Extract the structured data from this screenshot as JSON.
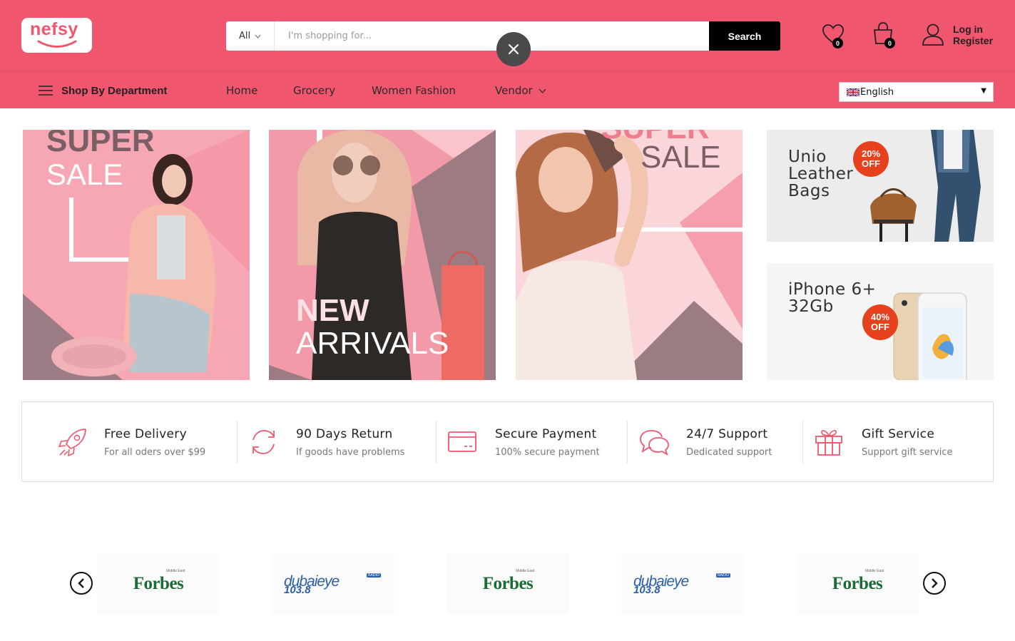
{
  "header": {
    "logo_text": "nefsy",
    "search": {
      "category": "All",
      "placeholder": "I'm shopping for...",
      "value": "",
      "button_label": "Search"
    },
    "wishlist_count": "0",
    "cart_count": "0",
    "account": {
      "login_label": "Log in",
      "register_label": "Register"
    },
    "brand_color": "#f0566e"
  },
  "nav": {
    "department_label": "Shop By Department",
    "items": [
      {
        "label": "Home"
      },
      {
        "label": "Grocery"
      },
      {
        "label": "Women Fashion"
      },
      {
        "label": "Vendor"
      }
    ],
    "language": "English"
  },
  "banners": {
    "b1": {
      "line1": "SUPER",
      "line2": "SALE"
    },
    "b2": {
      "line1": "NEW",
      "line2": "ARRIVALS"
    },
    "b3": {
      "line1": "SUPER",
      "line2": "SALE"
    },
    "side1": {
      "title_lines": [
        "Unio",
        "Leather",
        "Bags"
      ],
      "discount": "20%",
      "off": "OFF"
    },
    "side2": {
      "title_lines": [
        "iPhone 6+",
        "32Gb"
      ],
      "discount": "40%",
      "off": "OFF"
    }
  },
  "features": [
    {
      "title": "Free Delivery",
      "subtitle": "For all oders over $99",
      "icon": "rocket-icon"
    },
    {
      "title": "90 Days Return",
      "subtitle": "If goods have problems",
      "icon": "refresh-icon"
    },
    {
      "title": "Secure Payment",
      "subtitle": "100% secure payment",
      "icon": "credit-card-icon"
    },
    {
      "title": "24/7 Support",
      "subtitle": "Dedicated support",
      "icon": "chat-bubbles-icon"
    },
    {
      "title": "Gift Service",
      "subtitle": "Support gift service",
      "icon": "gift-icon"
    }
  ],
  "press": {
    "logos": [
      {
        "name": "Forbes",
        "tag": "Middle East"
      },
      {
        "name_top": "dubaieye",
        "name_bottom": "103.8",
        "tag": "RADIO"
      },
      {
        "name": "Forbes",
        "tag": "Middle East"
      },
      {
        "name_top": "dubaieye",
        "name_bottom": "103.8",
        "tag": "RADIO"
      },
      {
        "name": "Forbes",
        "tag": "Middle East"
      }
    ]
  }
}
